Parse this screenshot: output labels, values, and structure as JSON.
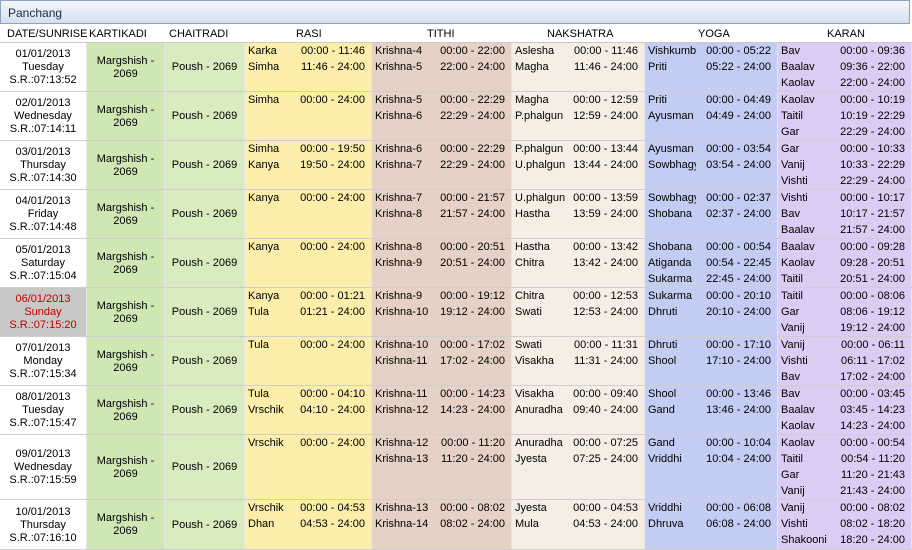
{
  "window": {
    "title": "Panchang"
  },
  "headers": {
    "date": "DATE/SUNRISE",
    "kartikadi": "KARTIKADI",
    "chaitradi": "CHAITRADI",
    "rasi": "RASI",
    "tithi": "TITHI",
    "nakshatra": "NAKSHATRA",
    "yoga": "YOGA",
    "karan": "KARAN"
  },
  "colors": {
    "kartikadi": "#cfe8b3",
    "chaitradi": "#d8ecbf",
    "rasi": "#fbeeaa",
    "tithi": "#e5d1c6",
    "nakshatra": "#f4eee5",
    "yoga": "#c3cdf4",
    "karan": "#dccbf3",
    "selected_text": "#c00000"
  },
  "rows": [
    {
      "date": "01/01/2013",
      "day": "Tuesday",
      "sunrise": "S.R.:07:13:52",
      "kartikadi": "Margshish - 2069",
      "chaitradi": "Poush - 2069",
      "rasi": [
        {
          "name": "Karka",
          "time": "00:00 - 11:46"
        },
        {
          "name": "Simha",
          "time": "11:46 - 24:00"
        }
      ],
      "tithi": [
        {
          "name": "Krishna-4",
          "time": "00:00 - 22:00"
        },
        {
          "name": "Krishna-5",
          "time": "22:00 - 24:00"
        }
      ],
      "nakshatra": [
        {
          "name": "Aslesha",
          "time": "00:00 - 11:46"
        },
        {
          "name": "Magha",
          "time": "11:46 - 24:00"
        }
      ],
      "yoga": [
        {
          "name": "Vishkumbh",
          "time": "00:00 - 05:22"
        },
        {
          "name": "Priti",
          "time": "05:22 - 24:00"
        }
      ],
      "karan": [
        {
          "name": "Bav",
          "time": "00:00 - 09:36"
        },
        {
          "name": "Baalav",
          "time": "09:36 - 22:00"
        },
        {
          "name": "Kaolav",
          "time": "22:00 - 24:00"
        }
      ]
    },
    {
      "date": "02/01/2013",
      "day": "Wednesday",
      "sunrise": "S.R.:07:14:11",
      "kartikadi": "Margshish - 2069",
      "chaitradi": "Poush - 2069",
      "rasi": [
        {
          "name": "Simha",
          "time": "00:00 - 24:00"
        }
      ],
      "tithi": [
        {
          "name": "Krishna-5",
          "time": "00:00 - 22:29"
        },
        {
          "name": "Krishna-6",
          "time": "22:29 - 24:00"
        }
      ],
      "nakshatra": [
        {
          "name": "Magha",
          "time": "00:00 - 12:59"
        },
        {
          "name": "P.phalgun",
          "time": "12:59 - 24:00"
        }
      ],
      "yoga": [
        {
          "name": "Priti",
          "time": "00:00 - 04:49"
        },
        {
          "name": "Ayusman",
          "time": "04:49 - 24:00"
        }
      ],
      "karan": [
        {
          "name": "Kaolav",
          "time": "00:00 - 10:19"
        },
        {
          "name": "Taitil",
          "time": "10:19 - 22:29"
        },
        {
          "name": "Gar",
          "time": "22:29 - 24:00"
        }
      ]
    },
    {
      "date": "03/01/2013",
      "day": "Thursday",
      "sunrise": "S.R.:07:14:30",
      "kartikadi": "Margshish - 2069",
      "chaitradi": "Poush - 2069",
      "rasi": [
        {
          "name": "Simha",
          "time": "00:00 - 19:50"
        },
        {
          "name": "Kanya",
          "time": "19:50 - 24:00"
        }
      ],
      "tithi": [
        {
          "name": "Krishna-6",
          "time": "00:00 - 22:29"
        },
        {
          "name": "Krishna-7",
          "time": "22:29 - 24:00"
        }
      ],
      "nakshatra": [
        {
          "name": "P.phalgun",
          "time": "00:00 - 13:44"
        },
        {
          "name": "U.phalgun",
          "time": "13:44 - 24:00"
        }
      ],
      "yoga": [
        {
          "name": "Ayusman",
          "time": "00:00 - 03:54"
        },
        {
          "name": "Sowbhagya",
          "time": "03:54 - 24:00"
        }
      ],
      "karan": [
        {
          "name": "Gar",
          "time": "00:00 - 10:33"
        },
        {
          "name": "Vanij",
          "time": "10:33 - 22:29"
        },
        {
          "name": "Vishti",
          "time": "22:29 - 24:00"
        }
      ]
    },
    {
      "date": "04/01/2013",
      "day": "Friday",
      "sunrise": "S.R.:07:14:48",
      "kartikadi": "Margshish - 2069",
      "chaitradi": "Poush - 2069",
      "rasi": [
        {
          "name": "Kanya",
          "time": "00:00 - 24:00"
        }
      ],
      "tithi": [
        {
          "name": "Krishna-7",
          "time": "00:00 - 21:57"
        },
        {
          "name": "Krishna-8",
          "time": "21:57 - 24:00"
        }
      ],
      "nakshatra": [
        {
          "name": "U.phalgun",
          "time": "00:00 - 13:59"
        },
        {
          "name": "Hastha",
          "time": "13:59 - 24:00"
        }
      ],
      "yoga": [
        {
          "name": "Sowbhagya",
          "time": "00:00 - 02:37"
        },
        {
          "name": "Shobana",
          "time": "02:37 - 24:00"
        }
      ],
      "karan": [
        {
          "name": "Vishti",
          "time": "00:00 - 10:17"
        },
        {
          "name": "Bav",
          "time": "10:17 - 21:57"
        },
        {
          "name": "Baalav",
          "time": "21:57 - 24:00"
        }
      ]
    },
    {
      "date": "05/01/2013",
      "day": "Saturday",
      "sunrise": "S.R.:07:15:04",
      "kartikadi": "Margshish - 2069",
      "chaitradi": "Poush - 2069",
      "rasi": [
        {
          "name": "Kanya",
          "time": "00:00 - 24:00"
        }
      ],
      "tithi": [
        {
          "name": "Krishna-8",
          "time": "00:00 - 20:51"
        },
        {
          "name": "Krishna-9",
          "time": "20:51 - 24:00"
        }
      ],
      "nakshatra": [
        {
          "name": "Hastha",
          "time": "00:00 - 13:42"
        },
        {
          "name": "Chitra",
          "time": "13:42 - 24:00"
        }
      ],
      "yoga": [
        {
          "name": "Shobana",
          "time": "00:00 - 00:54"
        },
        {
          "name": "Atiganda",
          "time": "00:54 - 22:45"
        },
        {
          "name": "Sukarma",
          "time": "22:45 - 24:00"
        }
      ],
      "karan": [
        {
          "name": "Baalav",
          "time": "00:00 - 09:28"
        },
        {
          "name": "Kaolav",
          "time": "09:28 - 20:51"
        },
        {
          "name": "Taitil",
          "time": "20:51 - 24:00"
        }
      ]
    },
    {
      "date": "06/01/2013",
      "day": "Sunday",
      "sunrise": "S.R.:07:15:20",
      "selected": true,
      "kartikadi": "Margshish - 2069",
      "chaitradi": "Poush - 2069",
      "rasi": [
        {
          "name": "Kanya",
          "time": "00:00 - 01:21"
        },
        {
          "name": "Tula",
          "time": "01:21 - 24:00"
        }
      ],
      "tithi": [
        {
          "name": "Krishna-9",
          "time": "00:00 - 19:12"
        },
        {
          "name": "Krishna-10",
          "time": "19:12 - 24:00"
        }
      ],
      "nakshatra": [
        {
          "name": "Chitra",
          "time": "00:00 - 12:53"
        },
        {
          "name": "Swati",
          "time": "12:53 - 24:00"
        }
      ],
      "yoga": [
        {
          "name": "Sukarma",
          "time": "00:00 - 20:10"
        },
        {
          "name": "Dhruti",
          "time": "20:10 - 24:00"
        }
      ],
      "karan": [
        {
          "name": "Taitil",
          "time": "00:00 - 08:06"
        },
        {
          "name": "Gar",
          "time": "08:06 - 19:12"
        },
        {
          "name": "Vanij",
          "time": "19:12 - 24:00"
        }
      ]
    },
    {
      "date": "07/01/2013",
      "day": "Monday",
      "sunrise": "S.R.:07:15:34",
      "kartikadi": "Margshish - 2069",
      "chaitradi": "Poush - 2069",
      "rasi": [
        {
          "name": "Tula",
          "time": "00:00 - 24:00"
        }
      ],
      "tithi": [
        {
          "name": "Krishna-10",
          "time": "00:00 - 17:02"
        },
        {
          "name": "Krishna-11",
          "time": "17:02 - 24:00"
        }
      ],
      "nakshatra": [
        {
          "name": "Swati",
          "time": "00:00 - 11:31"
        },
        {
          "name": "Visakha",
          "time": "11:31 - 24:00"
        }
      ],
      "yoga": [
        {
          "name": "Dhruti",
          "time": "00:00 - 17:10"
        },
        {
          "name": "Shool",
          "time": "17:10 - 24:00"
        }
      ],
      "karan": [
        {
          "name": "Vanij",
          "time": "00:00 - 06:11"
        },
        {
          "name": "Vishti",
          "time": "06:11 - 17:02"
        },
        {
          "name": "Bav",
          "time": "17:02 - 24:00"
        }
      ]
    },
    {
      "date": "08/01/2013",
      "day": "Tuesday",
      "sunrise": "S.R.:07:15:47",
      "kartikadi": "Margshish - 2069",
      "chaitradi": "Poush - 2069",
      "rasi": [
        {
          "name": "Tula",
          "time": "00:00 - 04:10"
        },
        {
          "name": "Vrschik",
          "time": "04:10 - 24:00"
        }
      ],
      "tithi": [
        {
          "name": "Krishna-11",
          "time": "00:00 - 14:23"
        },
        {
          "name": "Krishna-12",
          "time": "14:23 - 24:00"
        }
      ],
      "nakshatra": [
        {
          "name": "Visakha",
          "time": "00:00 - 09:40"
        },
        {
          "name": "Anuradha",
          "time": "09:40 - 24:00"
        }
      ],
      "yoga": [
        {
          "name": "Shool",
          "time": "00:00 - 13:46"
        },
        {
          "name": "Gand",
          "time": "13:46 - 24:00"
        }
      ],
      "karan": [
        {
          "name": "Bav",
          "time": "00:00 - 03:45"
        },
        {
          "name": "Baalav",
          "time": "03:45 - 14:23"
        },
        {
          "name": "Kaolav",
          "time": "14:23 - 24:00"
        }
      ]
    },
    {
      "date": "09/01/2013",
      "day": "Wednesday",
      "sunrise": "S.R.:07:15:59",
      "kartikadi": "Margshish - 2069",
      "chaitradi": "Poush - 2069",
      "rasi": [
        {
          "name": "Vrschik",
          "time": "00:00 - 24:00"
        }
      ],
      "tithi": [
        {
          "name": "Krishna-12",
          "time": "00:00 - 11:20"
        },
        {
          "name": "Krishna-13",
          "time": "11:20 - 24:00"
        }
      ],
      "nakshatra": [
        {
          "name": "Anuradha",
          "time": "00:00 - 07:25"
        },
        {
          "name": "Jyesta",
          "time": "07:25 - 24:00"
        }
      ],
      "yoga": [
        {
          "name": "Gand",
          "time": "00:00 - 10:04"
        },
        {
          "name": "Vriddhi",
          "time": "10:04 - 24:00"
        }
      ],
      "karan": [
        {
          "name": "Kaolav",
          "time": "00:00 - 00:54"
        },
        {
          "name": "Taitil",
          "time": "00:54 - 11:20"
        },
        {
          "name": "Gar",
          "time": "11:20 - 21:43"
        },
        {
          "name": "Vanij",
          "time": "21:43 - 24:00"
        }
      ]
    },
    {
      "date": "10/01/2013",
      "day": "Thursday",
      "sunrise": "S.R.:07:16:10",
      "kartikadi": "Margshish - 2069",
      "chaitradi": "Poush - 2069",
      "rasi": [
        {
          "name": "Vrschik",
          "time": "00:00 - 04:53"
        },
        {
          "name": "Dhan",
          "time": "04:53 - 24:00"
        }
      ],
      "tithi": [
        {
          "name": "Krishna-13",
          "time": "00:00 - 08:02"
        },
        {
          "name": "Krishna-14",
          "time": "08:02 - 24:00"
        }
      ],
      "nakshatra": [
        {
          "name": "Jyesta",
          "time": "00:00 - 04:53"
        },
        {
          "name": "Mula",
          "time": "04:53 - 24:00"
        }
      ],
      "yoga": [
        {
          "name": "Vriddhi",
          "time": "00:00 - 06:08"
        },
        {
          "name": "Dhruva",
          "time": "06:08 - 24:00"
        }
      ],
      "karan": [
        {
          "name": "Vanij",
          "time": "00:00 - 08:02"
        },
        {
          "name": "Vishti",
          "time": "08:02 - 18:20"
        },
        {
          "name": "Shakooni",
          "time": "18:20 - 24:00"
        }
      ]
    }
  ]
}
